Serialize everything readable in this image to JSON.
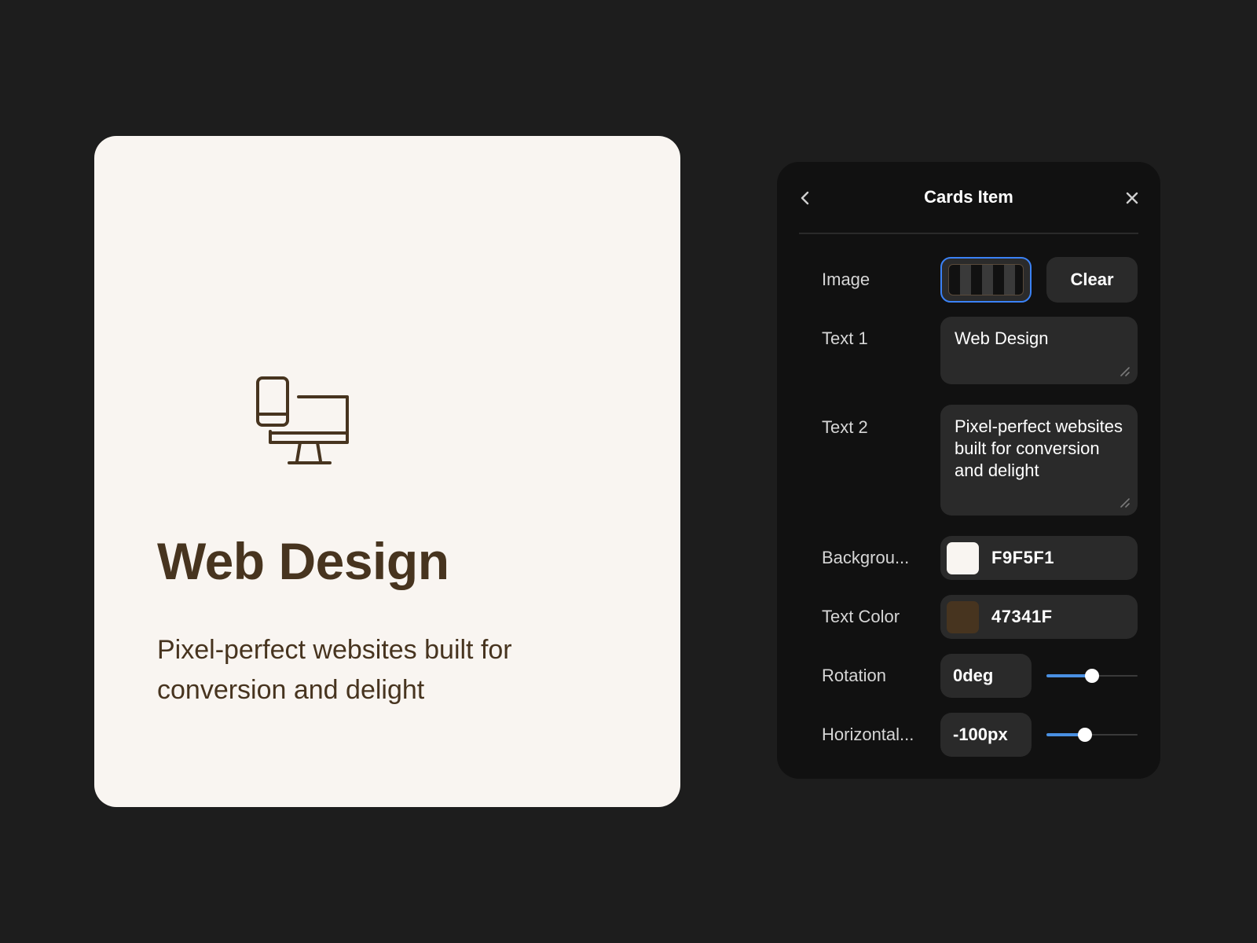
{
  "card": {
    "icon": "devices-icon",
    "title": "Web Design",
    "description": "Pixel-perfect websites built for conversion and delight",
    "background_color": "#F9F5F1",
    "text_color": "#47341F"
  },
  "panel": {
    "title": "Cards Item",
    "back_icon": "chevron-left-icon",
    "close_icon": "close-icon",
    "image": {
      "label": "Image",
      "clear_label": "Clear"
    },
    "text1": {
      "label": "Text 1",
      "value": "Web Design"
    },
    "text2": {
      "label": "Text 2",
      "value": "Pixel-perfect websites built for conversion and delight"
    },
    "background": {
      "label": "Backgrou...",
      "value": "F9F5F1",
      "swatch": "#F9F5F1"
    },
    "text_color": {
      "label": "Text Color",
      "value": "47341F",
      "swatch": "#47341F"
    },
    "rotation": {
      "label": "Rotation",
      "value": "0deg",
      "slider_fraction": 0.5
    },
    "horizontal": {
      "label": "Horizontal...",
      "value": "-100px",
      "slider_fraction": 0.42
    }
  },
  "colors": {
    "accent": "#4a90e2",
    "focus_border": "#3b82f6"
  }
}
